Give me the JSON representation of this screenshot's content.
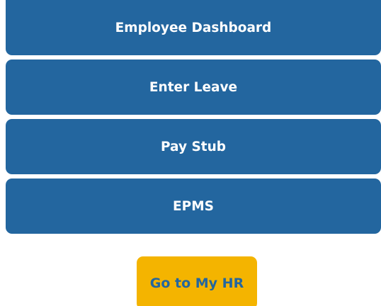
{
  "nav": {
    "items": [
      {
        "label": "Employee Dashboard"
      },
      {
        "label": "Enter Leave"
      },
      {
        "label": "Pay Stub"
      },
      {
        "label": "EPMS"
      }
    ]
  },
  "cta": {
    "label": "Go to My HR"
  },
  "colors": {
    "nav_bg": "#23669f",
    "nav_text": "#ffffff",
    "cta_bg": "#f4b400",
    "cta_text": "#23669f"
  }
}
